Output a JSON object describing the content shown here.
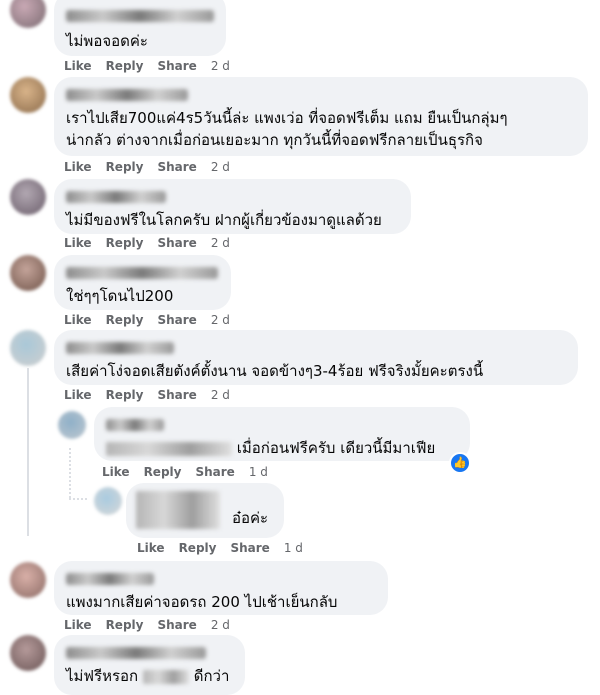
{
  "actions": {
    "like": "Like",
    "reply": "Reply",
    "share": "Share"
  },
  "comments": [
    {
      "text": "ไม่พอจอดค่ะ",
      "time": "2 d"
    },
    {
      "line1": "เราไปเสีย700แค่4ร5วันนี้ล่ะ แพงเว่อ ที่จอดฟรีเต็ม แถม ยืนเป็นกลุ่มๆ",
      "line2": "น่ากลัว ต่างจากเมื่อก่อนเยอะมาก ทุกวันนี้ที่จอดฟรีกลายเป็นธุรกิจ",
      "time": "2 d"
    },
    {
      "text": "ไม่มีของฟรีในโลกครับ ฝากผู้เกี่ยวข้องมาดูแลด้วย",
      "time": "2 d"
    },
    {
      "text": "ใช่ๆๆโดนไป200",
      "time": "2 d"
    },
    {
      "text": "เสียค่าโง่จอดเสียตังค์ตั้งนาน จอดข้างๆ3-4ร้อย ฟรีจริงมั้ยคะตรงนี้",
      "time": "2 d"
    },
    {
      "text": "แพงมากเสียค่าจอดรถ 200 ไปเช้าเย็นกลับ",
      "time": "2 d"
    },
    {
      "text_before": "ไม่ฟรีหรอก",
      "text_after": "ดีกว่า"
    }
  ],
  "replies": [
    {
      "text": "เมื่อก่อนฟรีครับ เดียวนี้มีมาเฟีย",
      "time": "1 d",
      "reaction_icon": "thumbs-up-icon"
    },
    {
      "text": "อ๋อค่ะ",
      "time": "1 d"
    }
  ],
  "colors": {
    "bubble": "#f0f2f5",
    "meta": "#65676b",
    "like_blue": "#1877f2"
  }
}
